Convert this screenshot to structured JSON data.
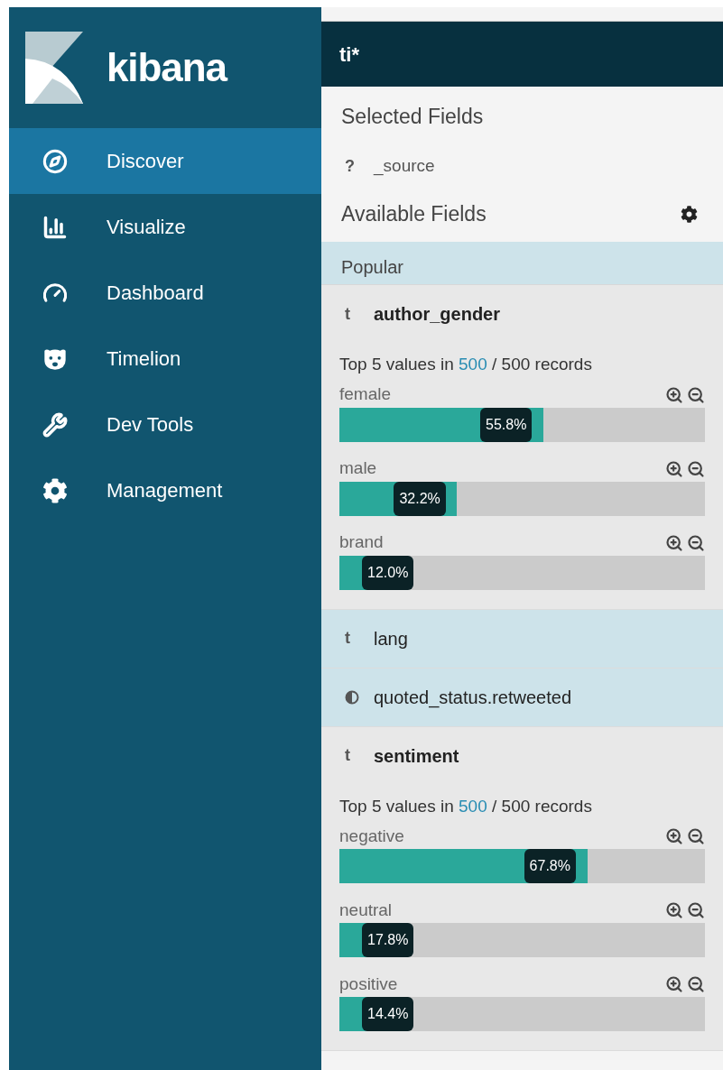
{
  "sidebar": {
    "logo_text": "kibana",
    "items": [
      {
        "label": "Discover",
        "selected": true
      },
      {
        "label": "Visualize",
        "selected": false
      },
      {
        "label": "Dashboard",
        "selected": false
      },
      {
        "label": "Timelion",
        "selected": false
      },
      {
        "label": "Dev Tools",
        "selected": false
      },
      {
        "label": "Management",
        "selected": false
      }
    ]
  },
  "index_pattern": "ti*",
  "selected_fields": {
    "title": "Selected Fields",
    "items": [
      {
        "kind": "unknown",
        "symbol": "?",
        "name": "_source"
      }
    ]
  },
  "available_fields": {
    "title": "Available Fields",
    "group": "Popular",
    "items": [
      {
        "kind": "string",
        "symbol": "t",
        "name": "author_gender",
        "expanded": true,
        "summary": {
          "prefix": "Top 5 values in",
          "count": "500",
          "suffix": "/ 500 records"
        },
        "values": [
          {
            "label": "female",
            "level": 0.558,
            "percent": "55.8%"
          },
          {
            "label": "male",
            "level": 0.322,
            "percent": "32.2%"
          },
          {
            "label": "brand",
            "level": 0.12,
            "percent": "12.0%"
          }
        ]
      },
      {
        "kind": "string",
        "symbol": "t",
        "name": "lang",
        "expanded": false
      },
      {
        "kind": "boolean",
        "name": "quoted_status.retweeted",
        "expanded": false
      },
      {
        "kind": "string",
        "symbol": "t",
        "name": "sentiment",
        "expanded": true,
        "summary": {
          "prefix": "Top 5 values in",
          "count": "500",
          "suffix": "/ 500 records"
        },
        "values": [
          {
            "label": "negative",
            "level": 0.678,
            "percent": "67.8%"
          },
          {
            "label": "neutral",
            "level": 0.178,
            "percent": "17.8%"
          },
          {
            "label": "positive",
            "level": 0.144,
            "percent": "14.4%"
          }
        ]
      }
    ]
  }
}
